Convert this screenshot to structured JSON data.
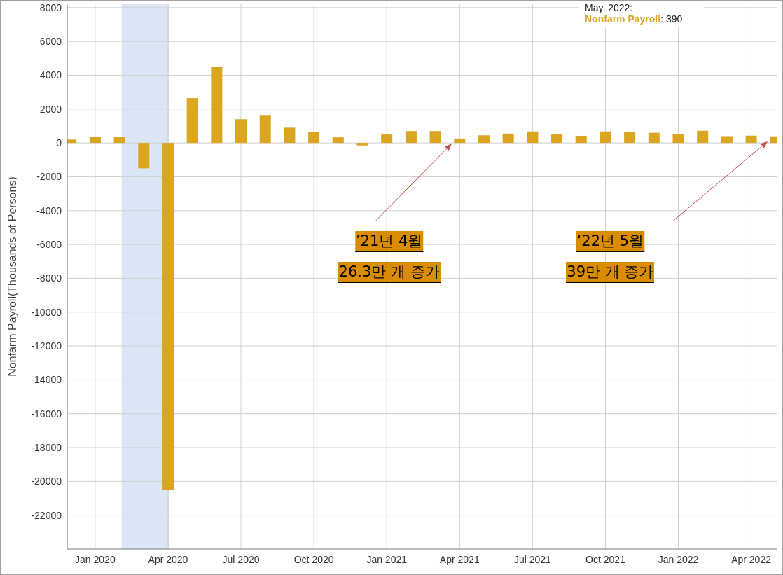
{
  "chart": {
    "chart_data": {
      "type": "bar",
      "ylabel": "Nonfarm Payroll(Thousands of Persons)",
      "grid": true,
      "categories": [
        null,
        "Jan 2020",
        null,
        null,
        "Apr 2020",
        null,
        null,
        "Jul 2020",
        null,
        null,
        "Oct 2020",
        null,
        null,
        "Jan 2021",
        null,
        null,
        "Apr 2021",
        null,
        null,
        "Jul 2021",
        null,
        null,
        "Oct 2021",
        null,
        null,
        "Jan 2022",
        null,
        null,
        "Apr 2022",
        null
      ],
      "series": [
        {
          "name": "Nonfarm Payroll",
          "color": "#daa520",
          "values": [
            200,
            350,
            370,
            -1500,
            -20500,
            2650,
            4500,
            1400,
            1650,
            900,
            650,
            330,
            -150,
            500,
            700,
            700,
            260,
            450,
            550,
            680,
            500,
            420,
            680,
            650,
            600,
            500,
            720,
            400,
            430,
            390
          ]
        }
      ],
      "ylim": [
        -24000,
        8200
      ],
      "yticks": [
        8000,
        6000,
        4000,
        2000,
        0,
        -2000,
        -4000,
        -6000,
        -8000,
        -10000,
        -12000,
        -14000,
        -16000,
        -18000,
        -20000,
        -22000
      ],
      "annotations": [
        {
          "text": "’21년 4월"
        },
        {
          "text": "26.3만 개 증가"
        },
        {
          "text": "‘22년 5월"
        },
        {
          "text": "39만 개 증가"
        }
      ]
    },
    "tooltip": {
      "title": "May, 2022:",
      "separator": ":",
      "value": "390"
    }
  }
}
